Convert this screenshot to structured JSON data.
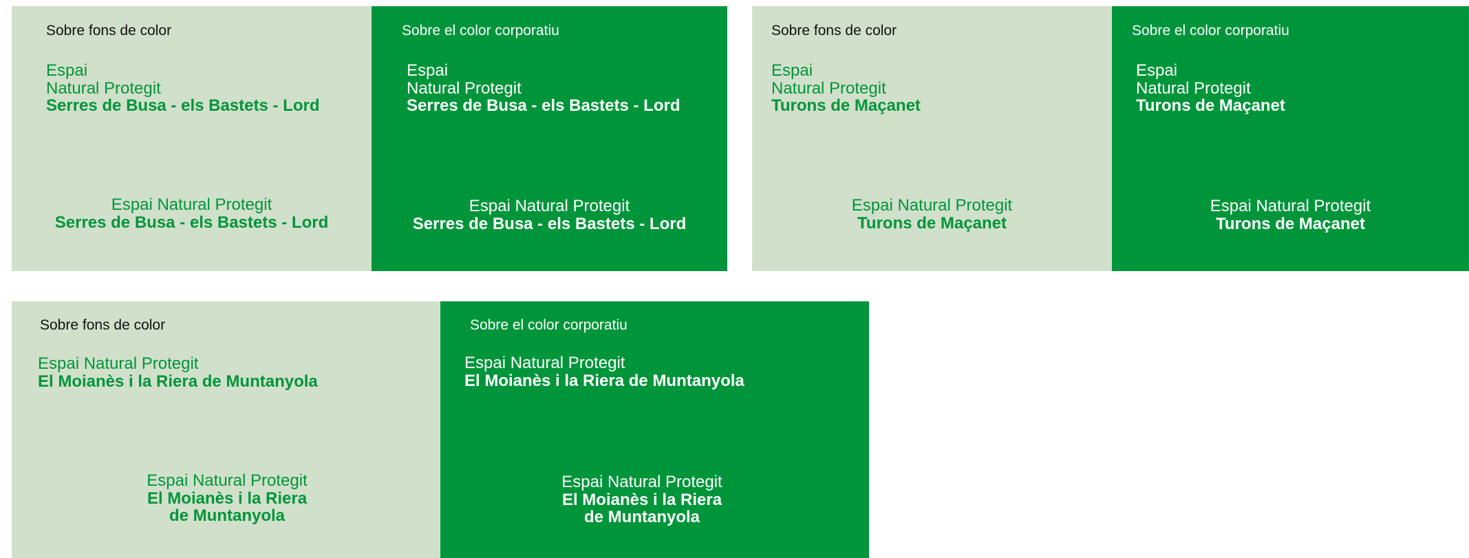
{
  "panels": {
    "serres_light": {
      "header": "Sobre fons de color",
      "stack": {
        "l1": "Espai",
        "l2": "Natural Protegit",
        "l3": "Serres de Busa - els Bastets - Lord"
      },
      "center": {
        "l1": "Espai Natural Protegit",
        "l2": "Serres de Busa - els Bastets - Lord"
      }
    },
    "serres_dark": {
      "header": "Sobre el color corporatiu",
      "stack": {
        "l1": "Espai",
        "l2": "Natural Protegit",
        "l3": "Serres de Busa - els Bastets - Lord"
      },
      "center": {
        "l1": "Espai Natural Protegit",
        "l2": "Serres de Busa - els Bastets - Lord"
      }
    },
    "turons_light": {
      "header": "Sobre fons de color",
      "stack": {
        "l1": "Espai",
        "l2": "Natural Protegit",
        "l3": "Turons de Maçanet"
      },
      "center": {
        "l1": "Espai Natural Protegit",
        "l2": "Turons de Maçanet"
      }
    },
    "turons_dark": {
      "header": "Sobre el color corporatiu",
      "stack": {
        "l1": "Espai",
        "l2": "Natural Protegit",
        "l3": "Turons de Maçanet"
      },
      "center": {
        "l1": "Espai Natural Protegit",
        "l2": "Turons de Maçanet"
      }
    },
    "moianes_light": {
      "header": "Sobre fons de color",
      "stack": {
        "l1": "Espai Natural Protegit",
        "l2": "El Moianès i la Riera de Muntanyola"
      },
      "center": {
        "l1": "Espai Natural Protegit",
        "l2": "El Moianès i la Riera",
        "l3": "de Muntanyola"
      }
    },
    "moianes_dark": {
      "header": "Sobre el color corporatiu",
      "stack": {
        "l1": "Espai Natural Protegit",
        "l2": "El Moianès i la Riera de Muntanyola"
      },
      "center": {
        "l1": "Espai Natural Protegit",
        "l2": "El Moianès i la Riera",
        "l3": "de Muntanyola"
      }
    }
  },
  "colors": {
    "light_background": "#d1e0cb",
    "corporate_green": "#00953a",
    "header_text_dark": "#111111",
    "text_white": "#ffffff"
  }
}
